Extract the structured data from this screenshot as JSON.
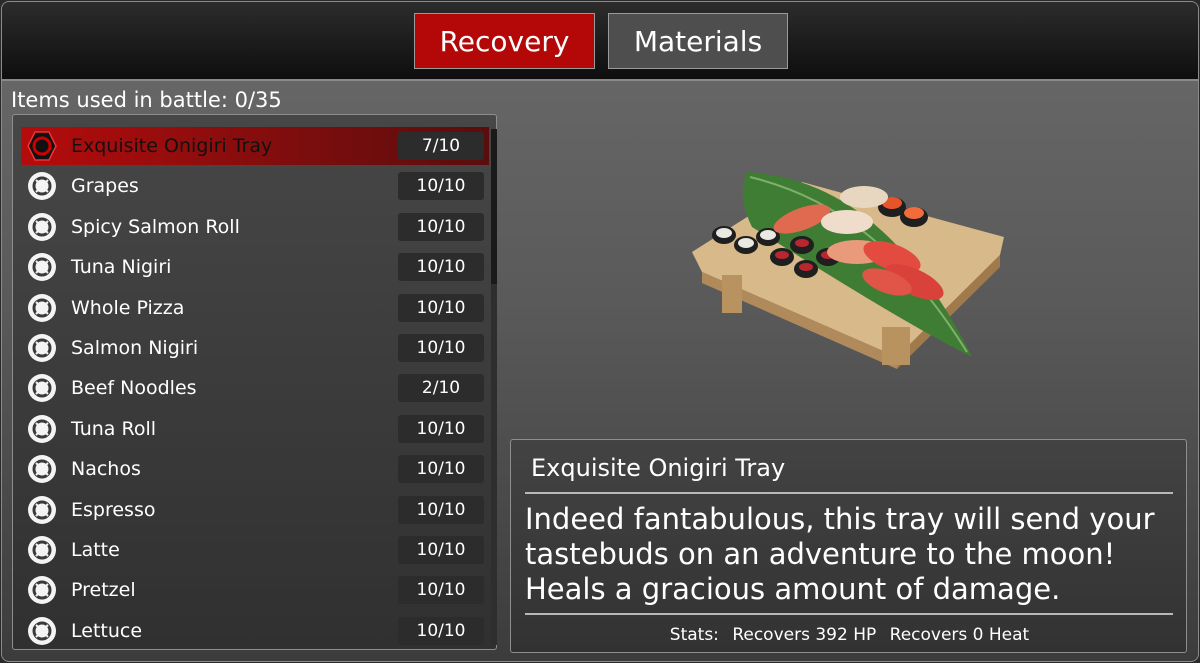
{
  "tabs": [
    {
      "label": "Recovery",
      "active": true
    },
    {
      "label": "Materials",
      "active": false
    }
  ],
  "items_used": "Items used in battle: 0/35",
  "items": [
    {
      "name": "Exquisite Onigiri Tray",
      "qty": "7/10",
      "selected": true
    },
    {
      "name": "Grapes",
      "qty": "10/10"
    },
    {
      "name": "Spicy Salmon Roll",
      "qty": "10/10"
    },
    {
      "name": "Tuna Nigiri",
      "qty": "10/10"
    },
    {
      "name": "Whole Pizza",
      "qty": "10/10"
    },
    {
      "name": "Salmon Nigiri",
      "qty": "10/10"
    },
    {
      "name": "Beef Noodles",
      "qty": "2/10"
    },
    {
      "name": "Tuna Roll",
      "qty": "10/10"
    },
    {
      "name": "Nachos",
      "qty": "10/10"
    },
    {
      "name": "Espresso",
      "qty": "10/10"
    },
    {
      "name": "Latte",
      "qty": "10/10"
    },
    {
      "name": "Pretzel",
      "qty": "10/10"
    },
    {
      "name": "Lettuce",
      "qty": "10/10"
    }
  ],
  "detail": {
    "title": "Exquisite Onigiri Tray",
    "description": "Indeed fantabulous, this tray will send your tastebuds on an adventure to the moon! Heals a gracious amount of damage.",
    "stats_label": "Stats:",
    "stat_hp": "Recovers 392 HP",
    "stat_heat": "Recovers 0 Heat"
  },
  "colors": {
    "accent_red": "#b40707",
    "item_icon": "lifebuoy-icon"
  }
}
